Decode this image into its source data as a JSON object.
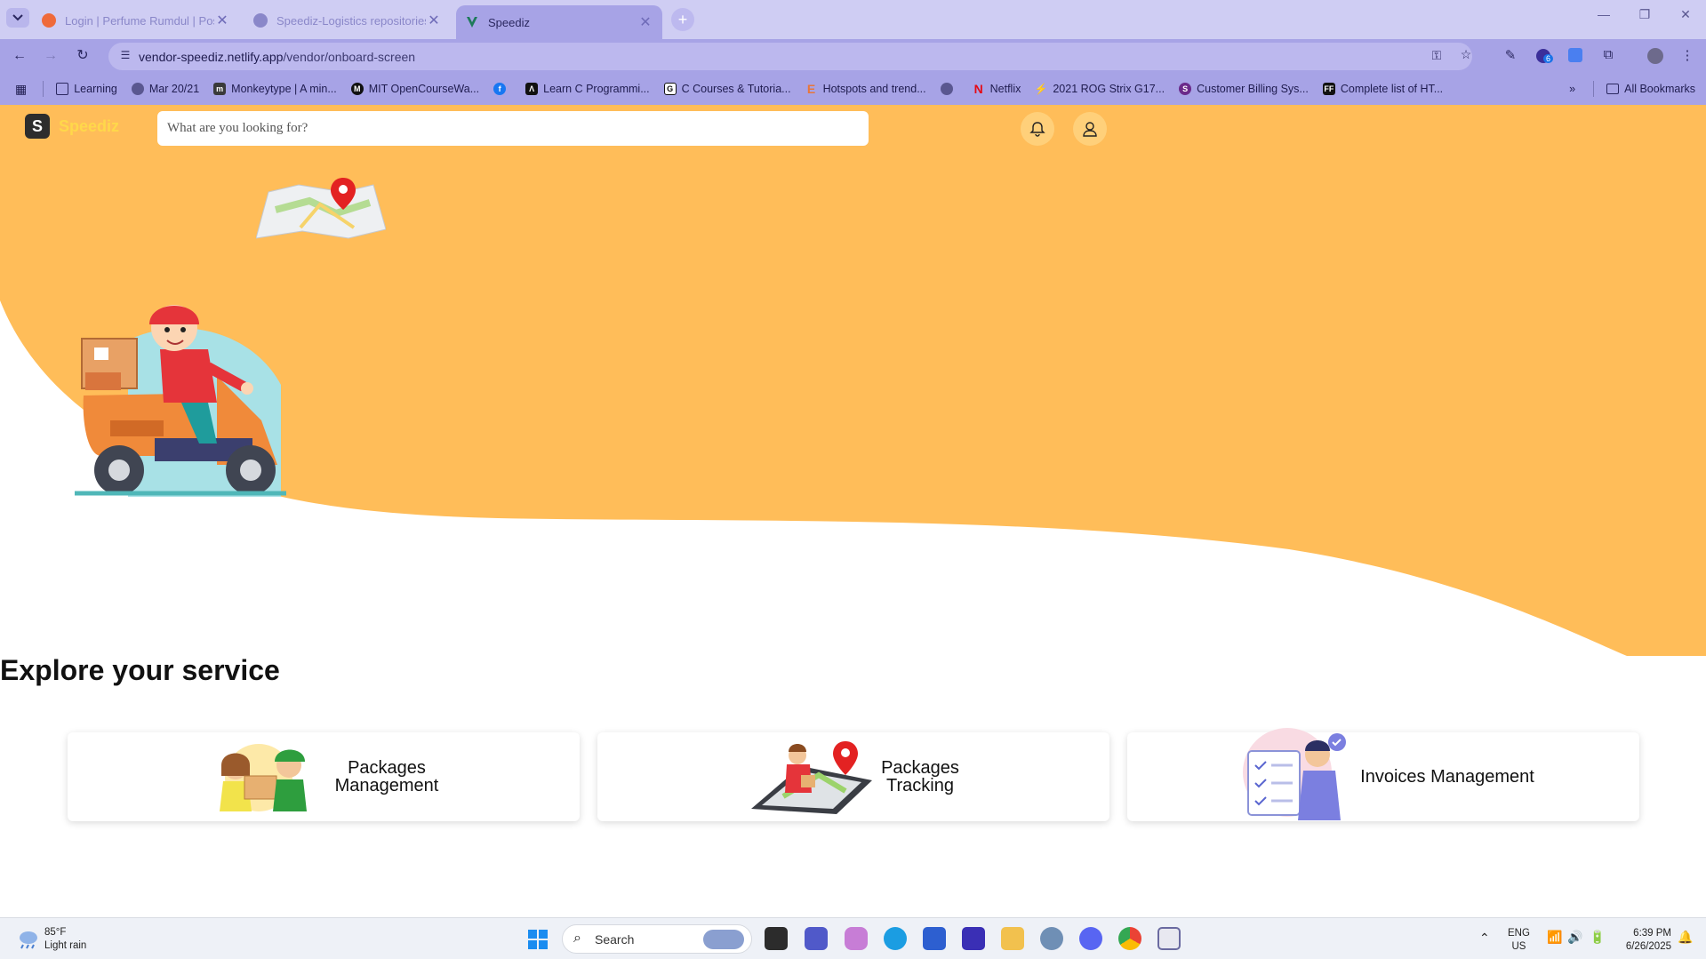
{
  "browser": {
    "tabs": [
      {
        "title": "Login | Perfume Rumdul | Postm",
        "active": false
      },
      {
        "title": "Speediz-Logistics repositories",
        "active": false
      },
      {
        "title": "Speediz",
        "active": true
      }
    ],
    "url_host": "vendor-speediz.netlify.app",
    "url_path": "/vendor/onboard-screen",
    "bookmarks": [
      "Learning",
      "Mar 20/21",
      "Monkeytype | A min...",
      "MIT OpenCourseWa...",
      "",
      "Learn C Programmi...",
      "C Courses & Tutoria...",
      "Hotspots and trend...",
      "",
      "Netflix",
      "2021 ROG Strix G17...",
      "Customer Billing Sys...",
      "Complete list of HT..."
    ],
    "all_bookmarks": "All Bookmarks",
    "ext_badge": "6",
    "colors": {
      "chrome_light": "#cfcdf3",
      "chrome": "#a7a3e6"
    }
  },
  "app": {
    "name": "Speediz",
    "logo_letter": "S",
    "search_placeholder": "What are you looking for?",
    "explore_title": "Explore your service",
    "services": [
      {
        "label_line1": "Packages",
        "label_line2": "Management",
        "icon": "people-with-package-illustration"
      },
      {
        "label_line1": "Packages",
        "label_line2": "Tracking",
        "icon": "map-tracking-illustration"
      },
      {
        "label_line1": "Invoices Management",
        "label_line2": "",
        "icon": "invoice-checklist-illustration"
      }
    ],
    "colors": {
      "hero": "#ffbd59",
      "logo_text": "#ffd84a"
    }
  },
  "taskbar": {
    "weather_temp": "85°F",
    "weather_desc": "Light rain",
    "search_label": "Search",
    "lang_line1": "ENG",
    "lang_line2": "US",
    "time": "6:39 PM",
    "date": "6/26/2025"
  }
}
